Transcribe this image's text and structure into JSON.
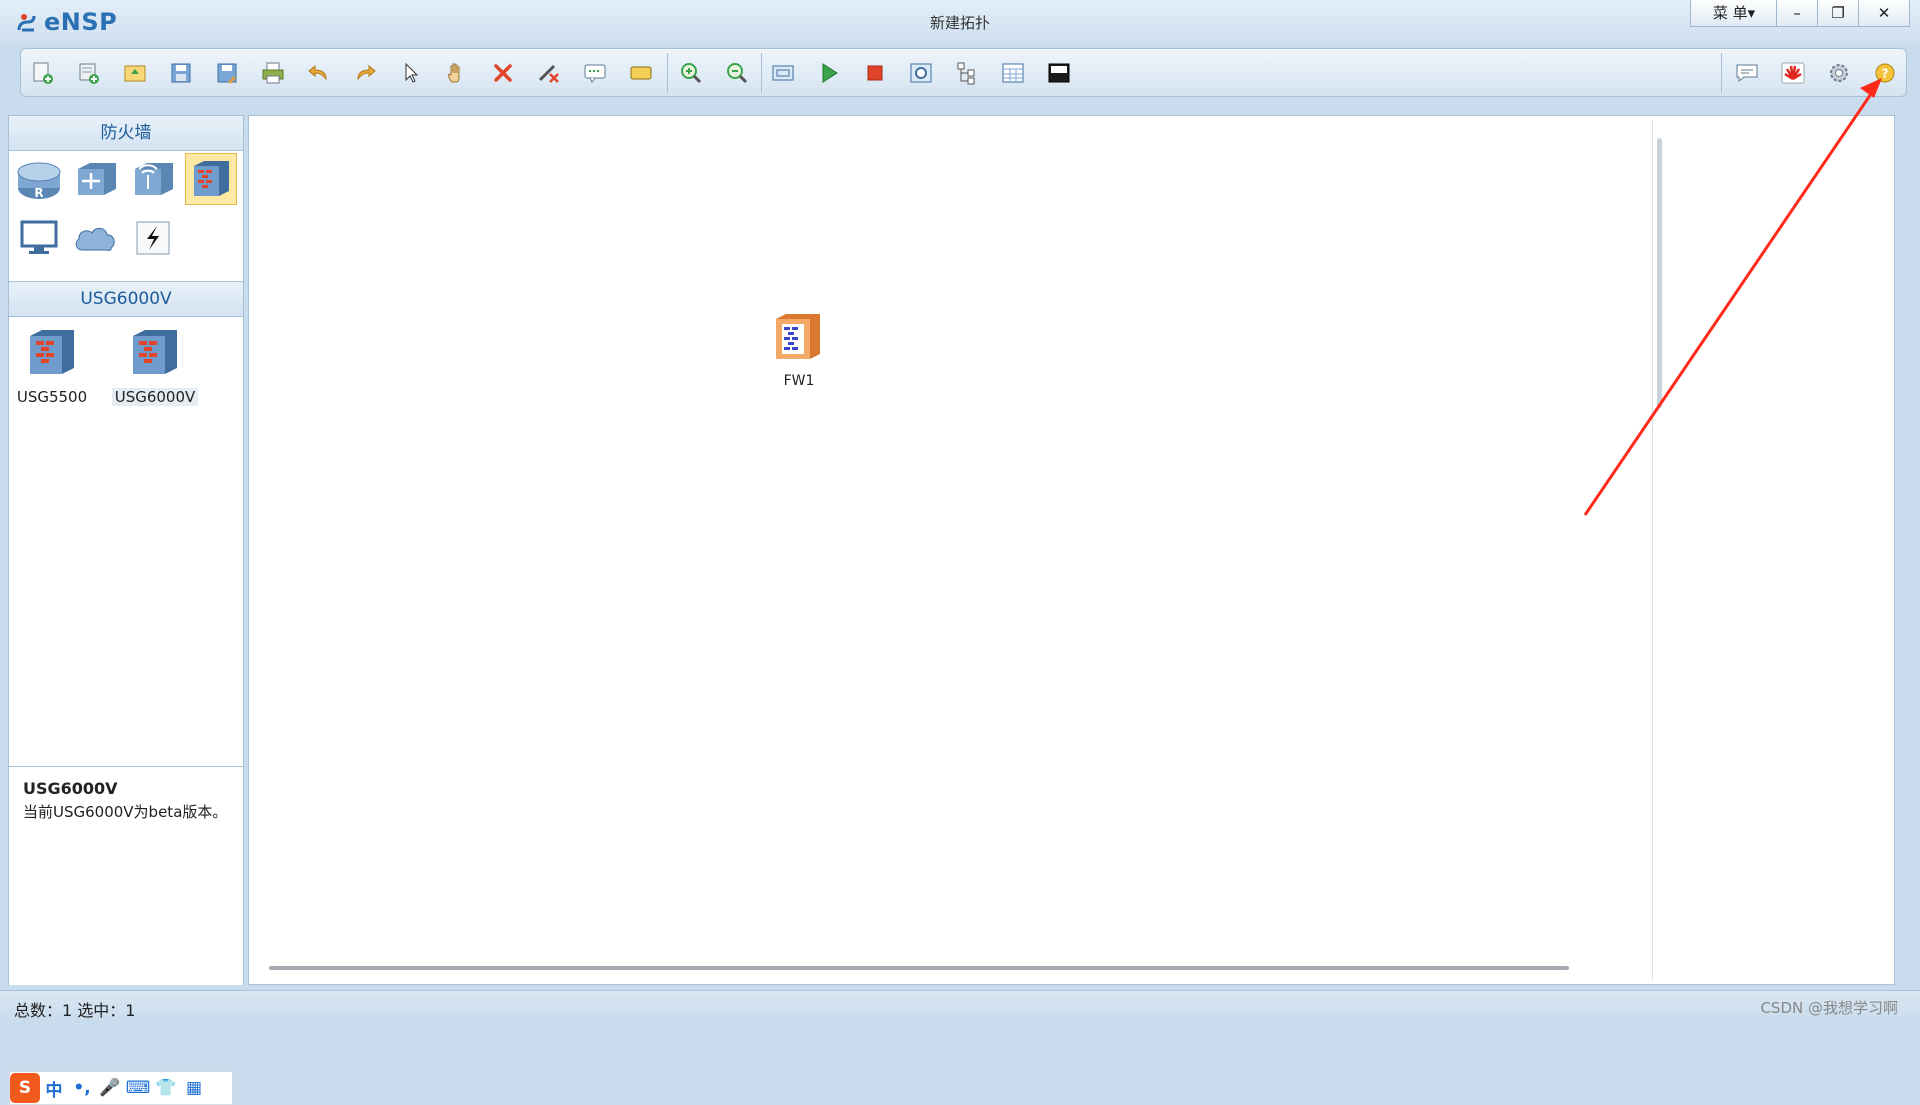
{
  "app": {
    "name": "eNSP",
    "window_title": "新建拓扑",
    "menu_label": "菜 单▾",
    "window_controls": {
      "minimize": "–",
      "restore": "❐",
      "close": "✕"
    }
  },
  "toolbar": {
    "left_buttons": [
      {
        "name": "new-topology-icon"
      },
      {
        "name": "new-lab-icon"
      },
      {
        "name": "open-icon"
      },
      {
        "name": "save-icon"
      },
      {
        "name": "save-as-icon"
      },
      {
        "name": "print-icon"
      },
      {
        "name": "undo-icon"
      },
      {
        "name": "redo-icon"
      },
      {
        "name": "select-pointer-icon"
      },
      {
        "name": "pan-hand-icon"
      },
      {
        "name": "delete-icon"
      },
      {
        "name": "delete-link-icon"
      },
      {
        "name": "add-text-icon"
      },
      {
        "name": "palette-icon"
      },
      {
        "name": "zoom-in-icon"
      },
      {
        "name": "zoom-out-icon"
      },
      {
        "name": "fit-view-icon"
      },
      {
        "name": "start-device-icon"
      },
      {
        "name": "stop-device-icon"
      },
      {
        "name": "capture-icon"
      },
      {
        "name": "topology-icon"
      },
      {
        "name": "grid-icon"
      },
      {
        "name": "screenshot-icon"
      }
    ],
    "right_buttons": [
      {
        "name": "forum-icon"
      },
      {
        "name": "huawei-icon"
      },
      {
        "name": "settings-icon"
      },
      {
        "name": "help-icon"
      }
    ]
  },
  "left_panel": {
    "category_header": "防火墙",
    "category_icons": [
      {
        "name": "router-icon"
      },
      {
        "name": "switch-icon"
      },
      {
        "name": "wireless-icon"
      },
      {
        "name": "firewall-icon"
      },
      {
        "name": "pc-icon"
      },
      {
        "name": "cloud-icon"
      },
      {
        "name": "link-icon"
      }
    ],
    "subcategory_header": "USG6000V",
    "devices": [
      {
        "label": "USG5500"
      },
      {
        "label": "USG6000V"
      }
    ],
    "description": {
      "title": "USG6000V",
      "text": "当前USG6000V为beta版本。"
    }
  },
  "canvas": {
    "nodes": [
      {
        "label": "FW1"
      }
    ]
  },
  "ime": {
    "items": [
      "S",
      "中",
      "•,",
      "🎤",
      "⌨",
      "👕",
      "▦"
    ]
  },
  "status": {
    "text": "总数：1  选中：1",
    "watermark": "CSDN @我想学习啊"
  },
  "colors": {
    "accent": "#2b6fb5",
    "annotation": "#ff2a1a"
  }
}
